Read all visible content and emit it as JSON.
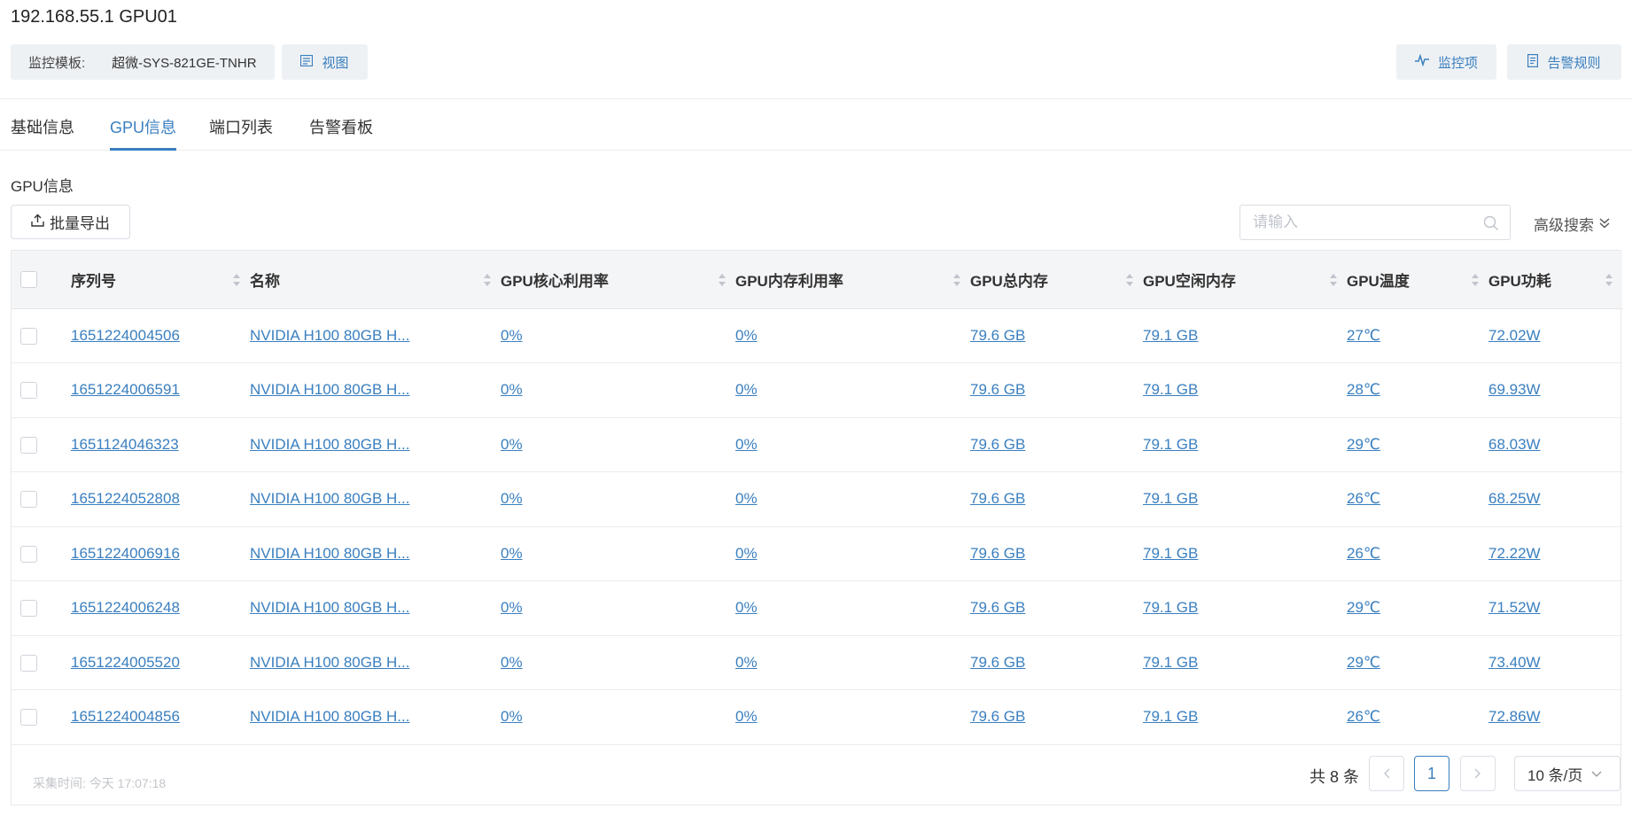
{
  "header": {
    "title": "192.168.55.1 GPU01",
    "template_label": "监控模板:",
    "template_value": "超微-SYS-821GE-TNHR",
    "view_button": "视图",
    "monitor_button": "监控项",
    "alarm_rule_button": "告警规则"
  },
  "tabs": [
    {
      "label": "基础信息",
      "active": false
    },
    {
      "label": "GPU信息",
      "active": true
    },
    {
      "label": "端口列表",
      "active": false
    },
    {
      "label": "告警看板",
      "active": false
    }
  ],
  "section": {
    "title": "GPU信息",
    "export_button": "批量导出",
    "search_placeholder": "请输入",
    "advanced_search": "高级搜索"
  },
  "table": {
    "columns": [
      "序列号",
      "名称",
      "GPU核心利用率",
      "GPU内存利用率",
      "GPU总内存",
      "GPU空闲内存",
      "GPU温度",
      "GPU功耗"
    ],
    "rows": [
      [
        "1651224004506",
        "NVIDIA H100 80GB H...",
        "0%",
        "0%",
        "79.6 GB",
        "79.1 GB",
        "27℃",
        "72.02W"
      ],
      [
        "1651224006591",
        "NVIDIA H100 80GB H...",
        "0%",
        "0%",
        "79.6 GB",
        "79.1 GB",
        "28℃",
        "69.93W"
      ],
      [
        "1651124046323",
        "NVIDIA H100 80GB H...",
        "0%",
        "0%",
        "79.6 GB",
        "79.1 GB",
        "29℃",
        "68.03W"
      ],
      [
        "1651224052808",
        "NVIDIA H100 80GB H...",
        "0%",
        "0%",
        "79.6 GB",
        "79.1 GB",
        "26℃",
        "68.25W"
      ],
      [
        "1651224006916",
        "NVIDIA H100 80GB H...",
        "0%",
        "0%",
        "79.6 GB",
        "79.1 GB",
        "26℃",
        "72.22W"
      ],
      [
        "1651224006248",
        "NVIDIA H100 80GB H...",
        "0%",
        "0%",
        "79.6 GB",
        "79.1 GB",
        "29℃",
        "71.52W"
      ],
      [
        "1651224005520",
        "NVIDIA H100 80GB H...",
        "0%",
        "0%",
        "79.6 GB",
        "79.1 GB",
        "29℃",
        "73.40W"
      ],
      [
        "1651224004856",
        "NVIDIA H100 80GB H...",
        "0%",
        "0%",
        "79.6 GB",
        "79.1 GB",
        "26℃",
        "72.86W"
      ]
    ]
  },
  "footer": {
    "collect_time": "采集时间: 今天 17:07:18",
    "total": "共 8 条",
    "current_page": "1",
    "page_size": "10 条/页"
  },
  "colors": {
    "accent": "#3a7fbf",
    "header_bg": "#f4f5f7",
    "button_bg": "#eef1f4"
  }
}
